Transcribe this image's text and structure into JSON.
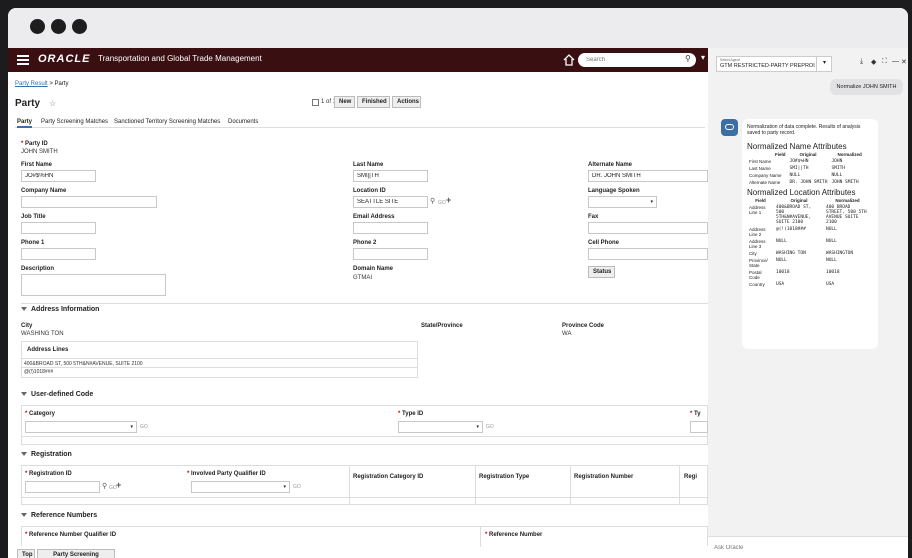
{
  "app": {
    "brand": "ORACLE",
    "name": "Transportation and Global Trade Management",
    "search_placeholder": "Search"
  },
  "breadcrumb": {
    "link": "Party Result",
    "sep": ">",
    "current": "Party"
  },
  "page": {
    "title": "Party",
    "pager": "1 of 1",
    "new_label": "New",
    "finished_label": "Finished",
    "actions_label": "Actions"
  },
  "tabs": [
    "Party",
    "Party Screening Matches",
    "Sanctioned Territory Screening Matches",
    "Documents"
  ],
  "fields": {
    "party_id_label": "Party ID",
    "party_id_value": "JOHN SMITH",
    "first_name_label": "First Name",
    "first_name_value": "JO#$%HN",
    "last_name_label": "Last Name",
    "last_name_value": "SMI||TH",
    "alternate_name_label": "Alternate Name",
    "alternate_name_value": "DR. JOHN SMITH",
    "company_name_label": "Company Name",
    "location_id_label": "Location ID",
    "location_id_value": "SEATTLE SITE",
    "language_label": "Language Spoken",
    "job_title_label": "Job Title",
    "email_label": "Email Address",
    "fax_label": "Fax",
    "phone1_label": "Phone 1",
    "phone2_label": "Phone 2",
    "cell_label": "Cell Phone",
    "description_label": "Description",
    "domain_label": "Domain Name",
    "domain_value": "GTMAI",
    "status_label": "Status",
    "go": "GO"
  },
  "address": {
    "section": "Address Information",
    "city_label": "City",
    "city_value": "WASHING TON",
    "state_label": "State/Province",
    "province_code_label": "Province Code",
    "province_code_value": "WA",
    "lines_header": "Address Lines",
    "line1": "400&BROAD ST, 500 5TH&N#AVENUE, SUITE 2100",
    "line2": "@(!)1018###"
  },
  "udc": {
    "section": "User-defined Code",
    "category_label": "Category",
    "type_id_label": "Type ID",
    "ty_label": "Ty"
  },
  "registration": {
    "section": "Registration",
    "reg_id_label": "Registration ID",
    "involved_label": "Involved Party Qualifier ID",
    "cat_label": "Registration Category ID",
    "type_label": "Registration Type",
    "num_label": "Registration Number",
    "regi_label": "Regi"
  },
  "reference": {
    "section": "Reference Numbers",
    "qual_label": "Reference Number Qualifier ID",
    "num_label": "Reference Number"
  },
  "bottom": {
    "top_label": "Top",
    "psm_label": "Party Screening Matches"
  },
  "assistant": {
    "agent_small": "Select Agent",
    "agent_value": "GTM RESTRICTED-PARTY PREPROI",
    "user_msg": "Normalize JOHN SMITH",
    "reply_intro": "Normalization of data complete. Results of analysis saved to party record.",
    "name_heading": "Normalized Name Attributes",
    "loc_heading": "Normalized Location Attributes",
    "col_field": "Field",
    "col_original": "Original",
    "col_normalized": "Normalized",
    "name_rows": [
      [
        "First Name",
        "JO#$%HN",
        "JOHN"
      ],
      [
        "Last Name",
        "SMI||TH",
        "SMITH"
      ],
      [
        "Company Name",
        "NULL",
        "NULL"
      ],
      [
        "Alternate Name",
        "DR. JOHN SMITH",
        "JOHN SMITH"
      ]
    ],
    "loc_rows": [
      [
        "Address Line 1",
        "400&BROAD ST, 500 5TH&N#AVENUE, SUITE 2100",
        "400 BROAD STREET, 500 5TH AVENUE SUITE 2100"
      ],
      [
        "Address Line 2",
        "@(!)1018###",
        "NULL"
      ],
      [
        "Address Line 3",
        "NULL",
        "NULL"
      ],
      [
        "City",
        "WASHING TON",
        "WASHINGTON"
      ],
      [
        "Province/ State",
        "NULL",
        "NULL"
      ],
      [
        "Postal Code",
        "10018",
        "10018"
      ],
      [
        "Country",
        "USA",
        "USA"
      ]
    ],
    "ask_placeholder": "Ask Oracle"
  },
  "colors": {
    "appbar": "#3a0f12",
    "accent": "#3b6ea5"
  }
}
